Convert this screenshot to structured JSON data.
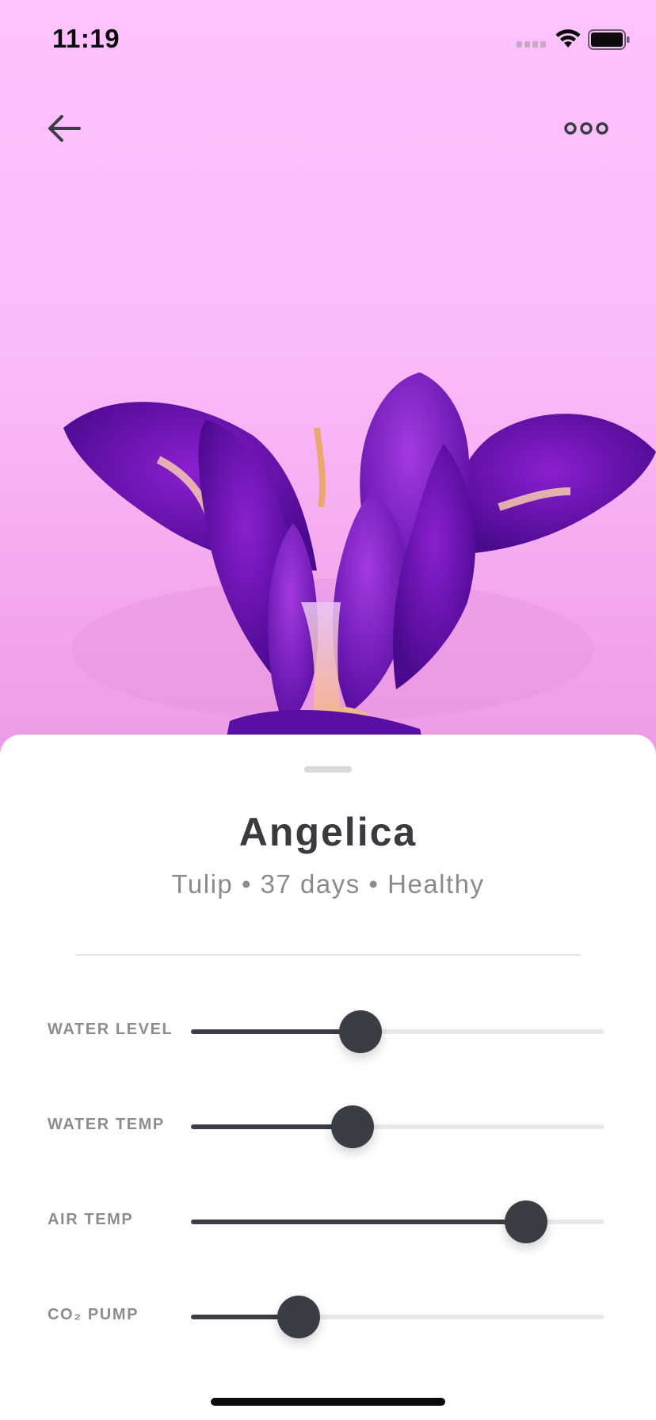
{
  "status_bar": {
    "time": "11:19"
  },
  "nav": {
    "back_icon": "arrow-left-icon",
    "more_icon": "more-horizontal-icon"
  },
  "hero": {
    "image": "purple-flower-photo",
    "background_color": "#fec2ff"
  },
  "plant": {
    "name": "Angelica",
    "meta": "Tulip • 37 days • Healthy"
  },
  "controls": [
    {
      "label": "WATER LEVEL",
      "value": 0.41
    },
    {
      "label": "WATER TEMP",
      "value": 0.39
    },
    {
      "label": "AIR TEMP",
      "value": 0.81
    },
    {
      "label": "CO₂ PUMP",
      "value": 0.26
    }
  ],
  "colors": {
    "accent": "#3b3d44",
    "track": "#e9e9ec",
    "label": "#8c8c91"
  }
}
